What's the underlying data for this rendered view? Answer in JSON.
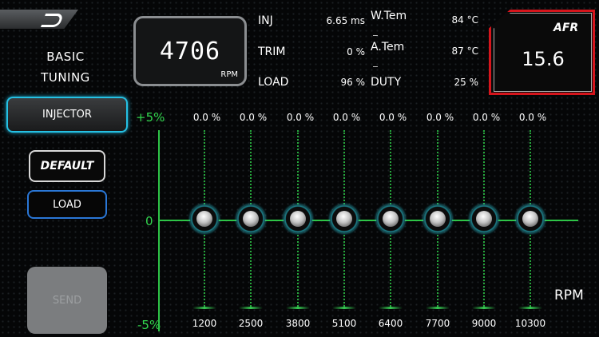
{
  "sidebar": {
    "title_line1": "BASIC",
    "title_line2": "TUNING",
    "injector_label": "INJECTOR",
    "default_label": "DEFAULT",
    "load_label": "LOAD",
    "send_label": "SEND"
  },
  "rpm": {
    "value": "4706",
    "unit": "RPM"
  },
  "stats": {
    "inj_label": "INJ",
    "inj_value": "6.65 ms",
    "trim_label": "TRIM",
    "trim_value": "0 %",
    "load_label": "LOAD",
    "load_value": "96 %",
    "wtem_label": "W.Tem",
    "wtem_value": "84 °C",
    "atem_label": "A.Tem",
    "atem_value": "87 °C",
    "duty_label": "DUTY",
    "duty_value": "25 %"
  },
  "afr": {
    "label": "AFR",
    "value": "15.6"
  },
  "graph": {
    "top_label": "+5%",
    "zero_label": "0",
    "bottom_label": "-5%",
    "rpm_axis_label": "RPM",
    "columns": [
      {
        "pct": "0.0 %",
        "rpm": "1200"
      },
      {
        "pct": "0.0 %",
        "rpm": "2500"
      },
      {
        "pct": "0.0 %",
        "rpm": "3800"
      },
      {
        "pct": "0.0 %",
        "rpm": "5100"
      },
      {
        "pct": "0.0 %",
        "rpm": "6400"
      },
      {
        "pct": "0.0 %",
        "rpm": "7700"
      },
      {
        "pct": "0.0 %",
        "rpm": "9000"
      },
      {
        "pct": "0.0 %",
        "rpm": "10300"
      }
    ]
  },
  "colors": {
    "accent_green": "#2ec447",
    "afr_red": "#d6151c",
    "injector_cyan": "#25c1e4",
    "load_blue": "#2a77d6"
  }
}
